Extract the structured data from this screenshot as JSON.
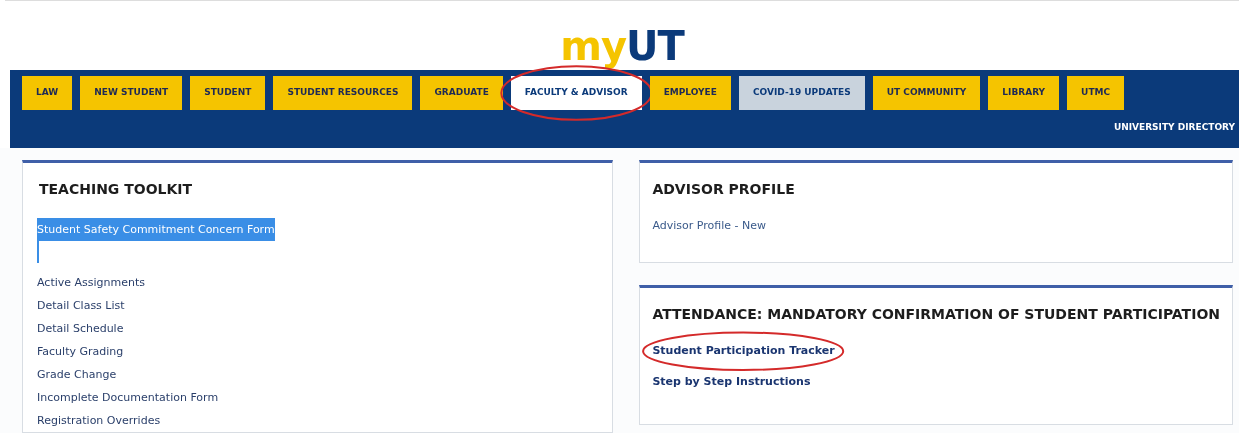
{
  "logo": {
    "part_1": "my",
    "part_2": "UT"
  },
  "nav": {
    "tabs": [
      {
        "label": "LAW",
        "kind": "normal",
        "selected": false,
        "circled": false
      },
      {
        "label": "NEW STUDENT",
        "kind": "normal",
        "selected": false,
        "circled": false
      },
      {
        "label": "STUDENT",
        "kind": "normal",
        "selected": false,
        "circled": false
      },
      {
        "label": "STUDENT RESOURCES",
        "kind": "normal",
        "selected": false,
        "circled": false
      },
      {
        "label": "GRADUATE",
        "kind": "normal",
        "selected": false,
        "circled": false
      },
      {
        "label": "FACULTY & ADVISOR",
        "selected": true,
        "circled": true
      },
      {
        "label": "EMPLOYEE",
        "kind": "normal",
        "selected": false,
        "circled": false
      },
      {
        "label": "COVID-19 UPDATES",
        "kind": "notice",
        "selected": false,
        "circled": false
      },
      {
        "label": "UT COMMUNITY",
        "kind": "normal",
        "selected": false,
        "circled": false
      },
      {
        "label": "LIBRARY",
        "kind": "normal",
        "selected": false,
        "circled": false
      },
      {
        "label": "UTMC",
        "kind": "normal",
        "selected": false,
        "circled": false
      }
    ],
    "directory_link": "UNIVERSITY DIRECTORY"
  },
  "teaching_toolkit": {
    "title": "TEACHING TOOLKIT",
    "links": [
      {
        "label": "Student Safety Commitment Concern Form",
        "selected": true
      },
      {
        "label": "Active Assignments",
        "selected": false
      },
      {
        "label": "Detail Class List",
        "selected": false
      },
      {
        "label": "Detail Schedule",
        "selected": false
      },
      {
        "label": "Faculty Grading",
        "selected": false
      },
      {
        "label": "Grade Change",
        "selected": false
      },
      {
        "label": "Incomplete Documentation Form",
        "selected": false
      },
      {
        "label": "Registration Overrides",
        "selected": false
      }
    ]
  },
  "advisor_profile": {
    "title": "ADVISOR PROFILE",
    "links": [
      {
        "label": "Advisor Profile - New"
      }
    ]
  },
  "attendance": {
    "title": "ATTENDANCE: MANDATORY CONFIRMATION OF STUDENT PARTICIPATION",
    "links": [
      {
        "label": "Student Participation Tracker",
        "circled": true
      },
      {
        "label": "Step by Step Instructions",
        "circled": false
      }
    ]
  }
}
